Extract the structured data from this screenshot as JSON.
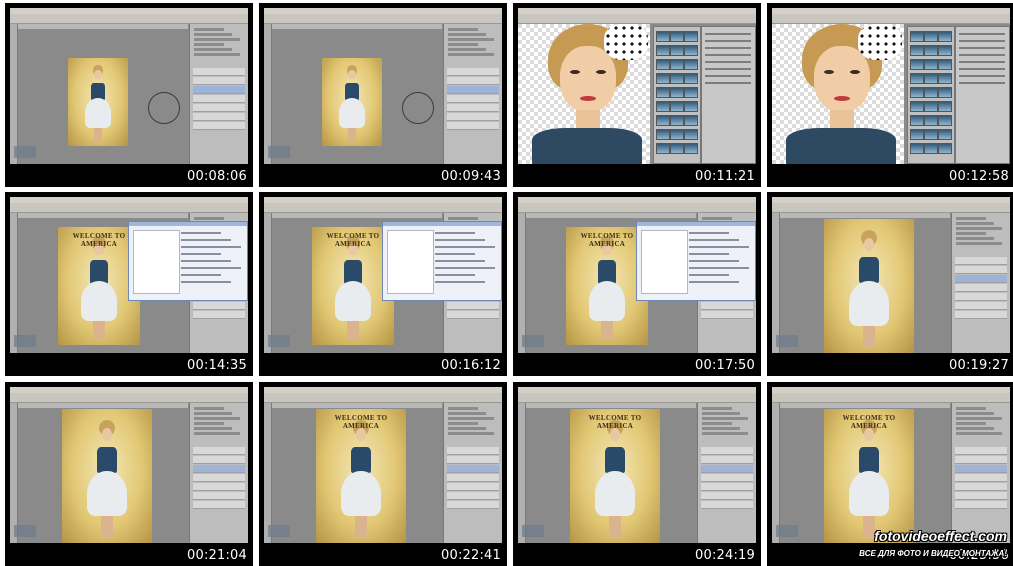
{
  "thumbnails": [
    {
      "time": "00:08:06",
      "variant": "photo-small"
    },
    {
      "time": "00:09:43",
      "variant": "photo-small"
    },
    {
      "time": "00:11:21",
      "variant": "closeup"
    },
    {
      "time": "00:12:58",
      "variant": "closeup"
    },
    {
      "time": "00:14:35",
      "variant": "dialog",
      "headline": "WELCOME TO AMERICA"
    },
    {
      "time": "00:16:12",
      "variant": "dialog",
      "headline": "WELCOME TO AMERICA"
    },
    {
      "time": "00:17:50",
      "variant": "dialog",
      "headline": "WELCOME TO AMERICA"
    },
    {
      "time": "00:19:27",
      "variant": "poster"
    },
    {
      "time": "00:21:04",
      "variant": "poster"
    },
    {
      "time": "00:22:41",
      "variant": "poster",
      "headline": "WELCOME TO AMERICA"
    },
    {
      "time": "00:24:19",
      "variant": "poster",
      "headline": "WELCOME TO AMERICA"
    },
    {
      "time": "00:25:56",
      "variant": "poster",
      "headline": "WELCOME TO AMERICA"
    }
  ],
  "watermark": {
    "site": "fotovideoeffect.com",
    "tagline": "ВСЕ ДЛЯ ФОТО И ВИДЕО МОНТАЖА!"
  },
  "colors": {
    "tile_bg": "#000000",
    "page_bg": "#ffffff",
    "timestamp": "#ffffff",
    "photoshop_canvas": "#8a8a8a"
  }
}
